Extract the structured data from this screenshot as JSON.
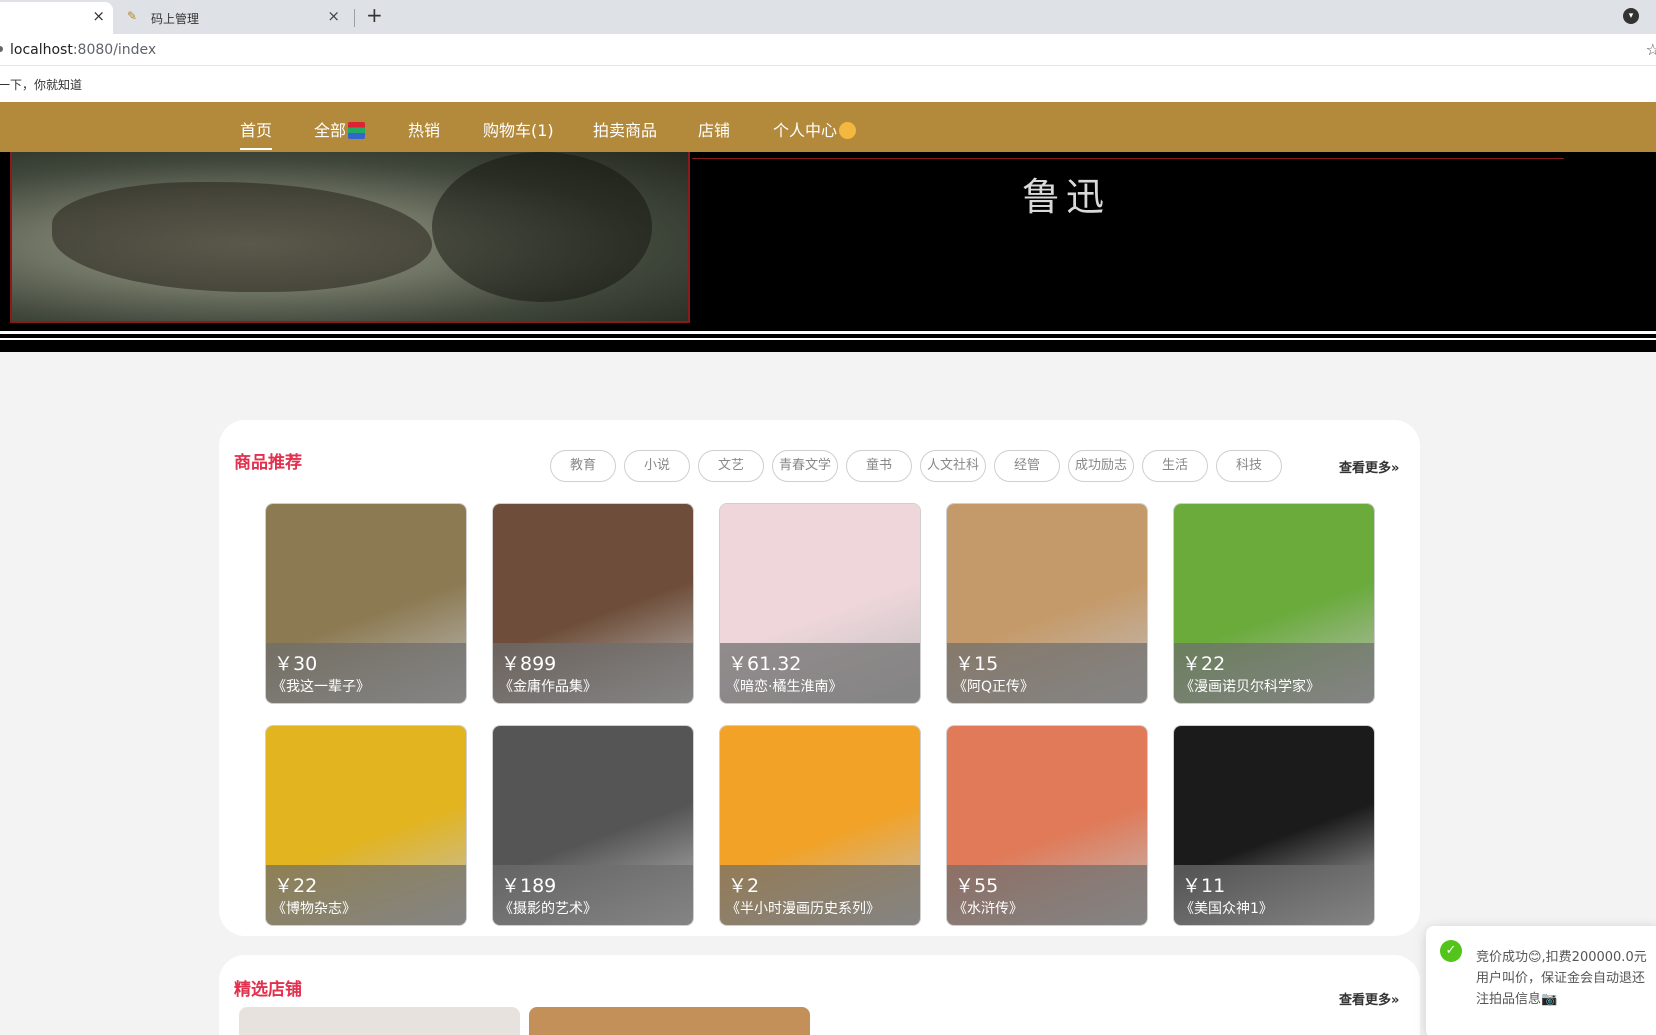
{
  "browser": {
    "tabs": [
      {
        "label": "",
        "close": "×"
      },
      {
        "label": "码上管理",
        "close": "×"
      }
    ],
    "new_tab": "+",
    "url_host": "localhost",
    "url_path": ":8080/index",
    "bookmark": "一下，你就知道"
  },
  "nav": {
    "items": [
      "首页",
      "全部",
      "热销",
      "购物车(1)",
      "拍卖商品",
      "店铺",
      "个人中心"
    ]
  },
  "banner": {
    "name": "鲁迅"
  },
  "recommend": {
    "title": "商品推荐",
    "categories": [
      "教育",
      "小说",
      "文艺",
      "青春文学",
      "童书",
      "人文社科",
      "经管",
      "成功励志",
      "生活",
      "科技"
    ],
    "more": "查看更多»",
    "products": [
      {
        "price": "￥30",
        "title": "《我这一辈子》",
        "color": "#8c7a52"
      },
      {
        "price": "￥899",
        "title": "《金庸作品集》",
        "color": "#6e4e3a"
      },
      {
        "price": "￥61.32",
        "title": "《暗恋·橘生淮南》",
        "color": "#eed6da"
      },
      {
        "price": "￥15",
        "title": "《阿Q正传》",
        "color": "#c59a6a"
      },
      {
        "price": "￥22",
        "title": "《漫画诺贝尔科学家》",
        "color": "#6aab3c"
      },
      {
        "price": "￥22",
        "title": "《博物杂志》",
        "color": "#e2b420"
      },
      {
        "price": "￥189",
        "title": "《摄影的艺术》",
        "color": "#555555"
      },
      {
        "price": "￥2",
        "title": "《半小时漫画历史系列》",
        "color": "#f2a226"
      },
      {
        "price": "￥55",
        "title": "《水浒传》",
        "color": "#e07a58"
      },
      {
        "price": "￥11",
        "title": "《美国众神1》",
        "color": "#1b1b1b"
      }
    ]
  },
  "shops": {
    "title": "精选店铺",
    "more": "查看更多»",
    "colors": [
      "#e8e2de",
      "#c4905a",
      "#ffffff"
    ]
  },
  "toast": {
    "line1": "竞价成功😊,扣费200000.0元",
    "line2": "用户叫价，保证金会自动退还",
    "line3": "注拍品信息📷"
  }
}
